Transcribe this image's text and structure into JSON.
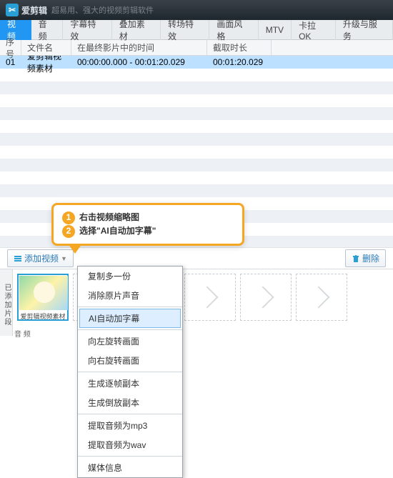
{
  "header": {
    "app_name": "爱剪辑",
    "tagline": "超易用、强大的视频剪辑软件"
  },
  "tabs": [
    "视频",
    "音频",
    "字幕特效",
    "叠加素材",
    "转场特效",
    "画面风格",
    "MTV",
    "卡拉OK",
    "升级与服务"
  ],
  "columns": {
    "c1": "序号",
    "c2": "文件名",
    "c3": "在最终影片中的时间",
    "c4": "截取时长"
  },
  "row0": {
    "idx": "01",
    "name": "爱剪辑视频素材",
    "time": "00:00:00.000 - 00:01:20.029",
    "dur": "00:01:20.029"
  },
  "buttons": {
    "add": "添加视频",
    "del": "删除"
  },
  "side_tab": "已添加片段",
  "thumb_label": "爱剪辑视频素材",
  "audio_label": "音 频",
  "callout": {
    "l1": "右击视频缩略图",
    "l2": "选择\"AI自动加字幕\""
  },
  "ctx": {
    "i1": "复制多一份",
    "i2": "消除原片声音",
    "i3": "AI自动加字幕",
    "i4": "向左旋转画面",
    "i5": "向右旋转画面",
    "i6": "生成逐帧副本",
    "i7": "生成倒放副本",
    "i8": "提取音频为mp3",
    "i9": "提取音频为wav",
    "i10": "媒体信息"
  }
}
